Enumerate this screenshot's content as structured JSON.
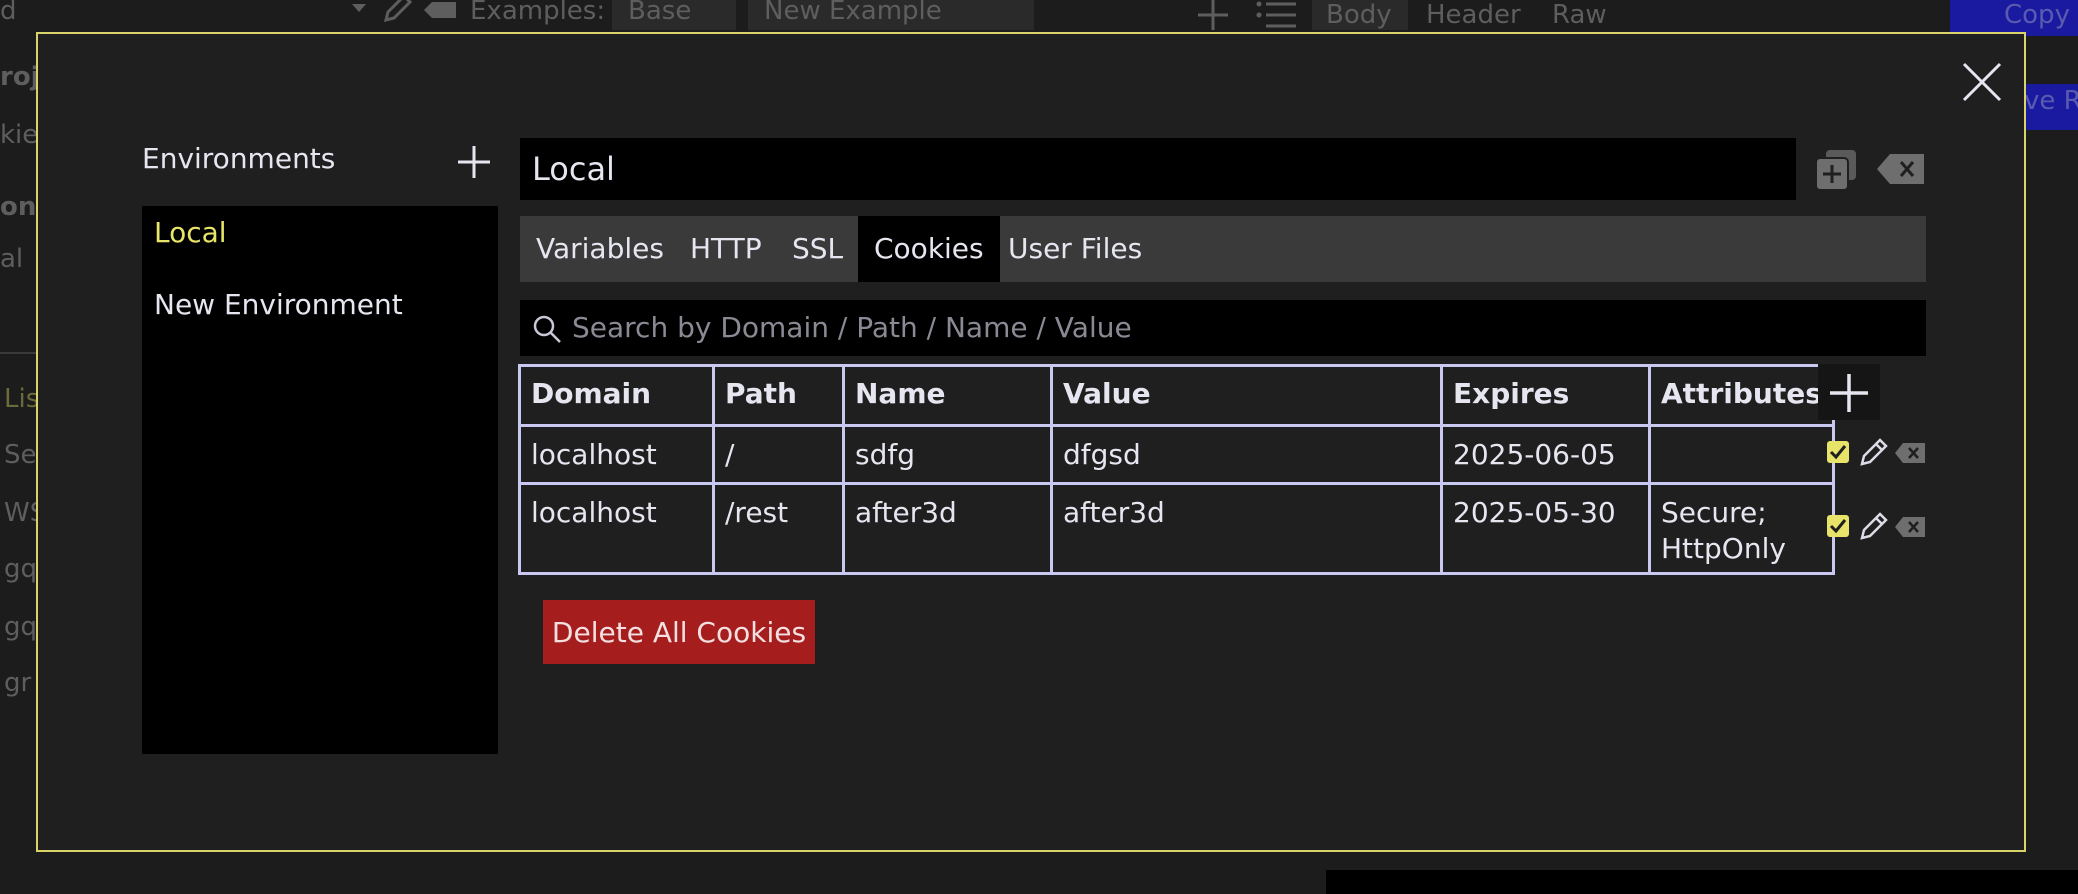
{
  "background": {
    "examples_label": "Examples:",
    "example_tabs": [
      "Base",
      "New Example"
    ],
    "body_tabs": [
      "Body",
      "Header",
      "Raw"
    ],
    "copy_label": "Copy",
    "save_fragment": "ve R",
    "left_fragments": [
      "d",
      "roj",
      "kie",
      "on",
      "al",
      "Lis",
      "Se",
      "WS",
      "gq",
      "gq",
      "gr"
    ]
  },
  "modal": {
    "environments": {
      "heading": "Environments",
      "items": [
        {
          "label": "Local",
          "selected": true
        },
        {
          "label": "New Environment",
          "selected": false
        }
      ]
    },
    "environment_name": "Local",
    "tabs": [
      {
        "label": "Variables",
        "active": false
      },
      {
        "label": "HTTP",
        "active": false
      },
      {
        "label": "SSL",
        "active": false
      },
      {
        "label": "Cookies",
        "active": true
      },
      {
        "label": "User Files",
        "active": false
      }
    ],
    "search": {
      "placeholder": "Search by Domain / Path / Name / Value"
    },
    "table": {
      "columns": [
        "Domain",
        "Path",
        "Name",
        "Value",
        "Expires",
        "Attributes"
      ],
      "rows": [
        {
          "domain": "localhost",
          "path": "/",
          "name": "sdfg",
          "value": "dfgsd",
          "expires": "2025-06-05",
          "attributes_line1": "",
          "attributes_line2": "",
          "enabled": true
        },
        {
          "domain": "localhost",
          "path": "/rest",
          "name": "after3d",
          "value": "after3d",
          "expires": "2025-05-30",
          "attributes_line1": "Secure;",
          "attributes_line2": "HttpOnly",
          "enabled": true
        }
      ]
    },
    "delete_all_label": "Delete All Cookies"
  },
  "colors": {
    "accent_yellow": "#e8e46a",
    "danger_red": "#a51d1d",
    "table_border": "#c8c8f0",
    "modal_border": "#d8d46a"
  }
}
